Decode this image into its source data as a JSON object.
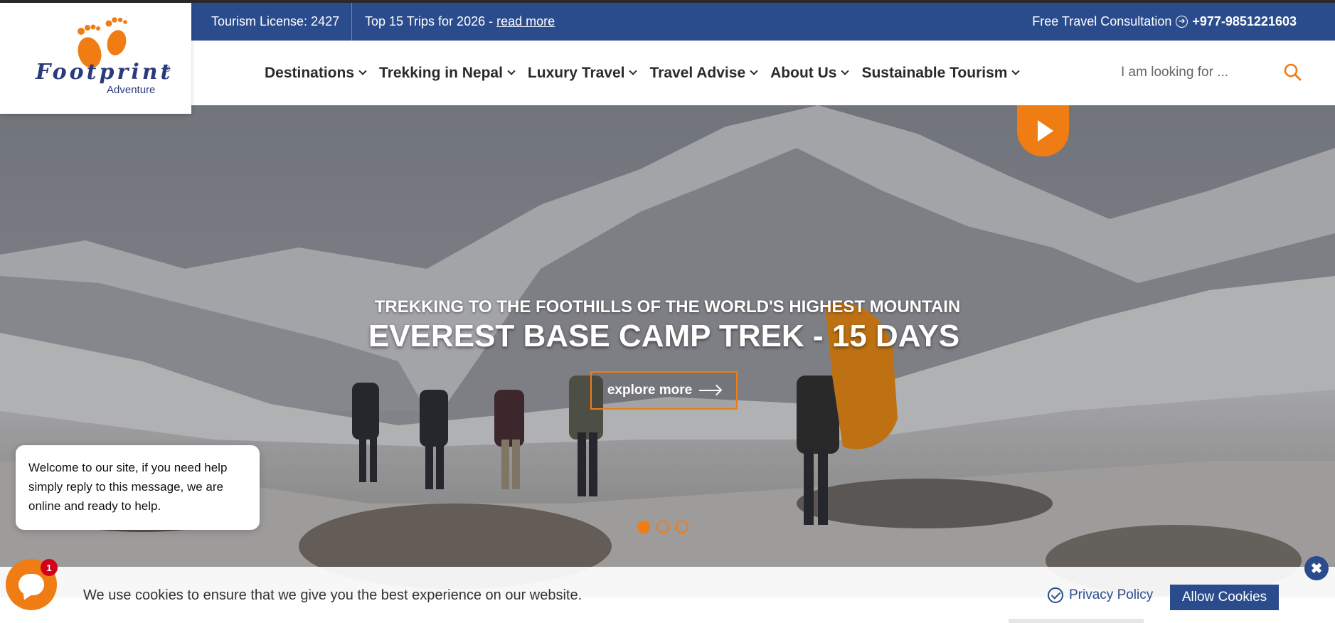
{
  "topbar": {
    "license": "Tourism License: 2427",
    "promo_text": "Top 15 Trips for 2026 - ",
    "promo_link": "read more",
    "consult_label": "Free Travel Consultation",
    "phone": "+977-9851221603"
  },
  "logo": {
    "name": "Footprint",
    "sub": "Adventure",
    "reg": "®"
  },
  "nav": {
    "items": [
      {
        "label": "Destinations"
      },
      {
        "label": "Trekking in Nepal"
      },
      {
        "label": "Luxury Travel"
      },
      {
        "label": "Travel Advise"
      },
      {
        "label": "About Us"
      },
      {
        "label": "Sustainable Tourism"
      }
    ],
    "search_placeholder": "I am looking for ..."
  },
  "hero": {
    "subtitle": "TREKKING TO THE FOOTHILLS OF THE WORLD'S HIGHEST MOUNTAIN",
    "title": "EVEREST BASE CAMP TREK - 15 DAYS",
    "cta": "explore more",
    "slide_count": 3,
    "active_slide": 1
  },
  "chat": {
    "message": "Welcome to our site, if you need help simply reply to this message, we are online and ready to help.",
    "badge": "1"
  },
  "cookie": {
    "text": "We use cookies to ensure that we give you the best experience on our website.",
    "privacy": "Privacy Policy",
    "allow": "Allow Cookies",
    "close": "✖"
  },
  "colors": {
    "brand_blue": "#2b4c8c",
    "brand_orange": "#f07c14"
  }
}
